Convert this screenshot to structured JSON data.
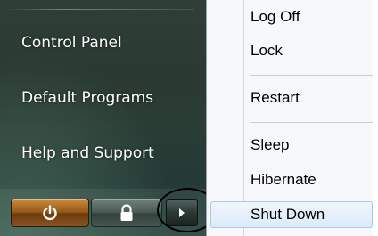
{
  "start_menu": {
    "left_items": [
      {
        "label": "Control Panel"
      },
      {
        "label": "Default Programs"
      },
      {
        "label": "Help and Support"
      }
    ]
  },
  "buttons": {
    "power_icon": "power-icon",
    "lock_icon": "lock-icon",
    "arrow_icon": "right-arrow-icon"
  },
  "submenu": {
    "items": [
      {
        "label": "Log Off"
      },
      {
        "label": "Lock"
      },
      {
        "label": "Restart"
      },
      {
        "label": "Sleep"
      },
      {
        "label": "Hibernate"
      },
      {
        "label": "Shut Down",
        "highlighted": true
      }
    ]
  },
  "colors": {
    "left_pane": "#2b3a33",
    "power_button": "#9a5a1a",
    "submenu_bg": "#f7f8fa",
    "highlight": "#dbeafa"
  }
}
